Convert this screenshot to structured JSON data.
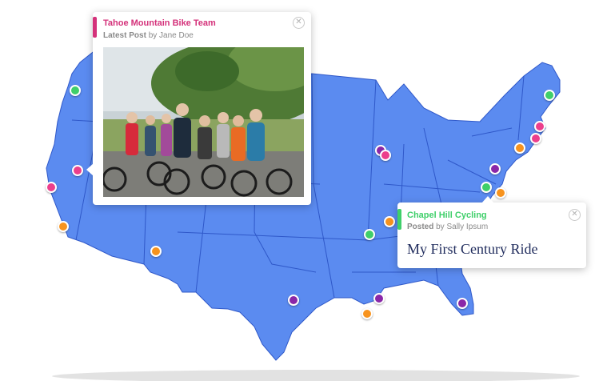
{
  "map": {
    "land_color": "#5b8bf0",
    "border_color": "#2f58c9",
    "shadow_color": "#d4d4d4"
  },
  "marker_colors": {
    "green": "#3fcf6a",
    "pink": "#ec3f8c",
    "orange": "#f7931e",
    "purple": "#8a27a8"
  },
  "markers": [
    {
      "id": "seattle",
      "color": "green"
    },
    {
      "id": "tahoe",
      "color": "pink"
    },
    {
      "id": "san-francisco",
      "color": "pink"
    },
    {
      "id": "los-angeles",
      "color": "orange"
    },
    {
      "id": "phoenix",
      "color": "orange"
    },
    {
      "id": "dallas",
      "color": "purple"
    },
    {
      "id": "chicago-1",
      "color": "purple"
    },
    {
      "id": "chicago-2",
      "color": "pink"
    },
    {
      "id": "st-louis",
      "color": "orange"
    },
    {
      "id": "nashville",
      "color": "green"
    },
    {
      "id": "new-orleans-1",
      "color": "purple"
    },
    {
      "id": "new-orleans-2",
      "color": "orange"
    },
    {
      "id": "orlando",
      "color": "purple"
    },
    {
      "id": "washington-dc",
      "color": "purple"
    },
    {
      "id": "chapel-hill",
      "color": "green"
    },
    {
      "id": "norfolk",
      "color": "orange"
    },
    {
      "id": "philadelphia",
      "color": "orange"
    },
    {
      "id": "new-york",
      "color": "pink"
    },
    {
      "id": "providence",
      "color": "pink"
    },
    {
      "id": "maine",
      "color": "green"
    }
  ],
  "popup_tahoe": {
    "accent_color": "#d4317a",
    "team_name": "Tahoe Mountain Bike Team",
    "post_label": "Latest Post",
    "post_author": "by Jane Doe",
    "close_symbol": "✕",
    "photo_icon": "group-cycling-photo"
  },
  "popup_chapel": {
    "accent_color": "#3fcf6a",
    "team_name": "Chapel Hill Cycling",
    "post_label": "Posted",
    "post_author": "by Sally Ipsum",
    "post_title": "My First Century Ride",
    "close_symbol": "✕"
  }
}
